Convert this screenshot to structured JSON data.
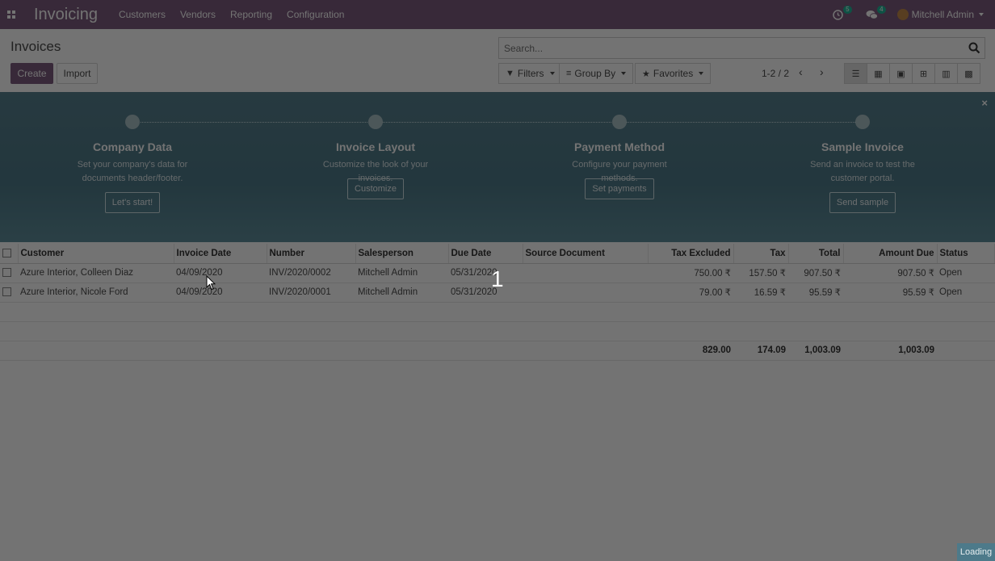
{
  "navbar": {
    "app_name": "Invoicing",
    "menu": [
      "Customers",
      "Vendors",
      "Reporting",
      "Configuration"
    ],
    "activity_count": "5",
    "messages_count": "4",
    "user": "Mitchell Admin"
  },
  "control_panel": {
    "title": "Invoices",
    "create_label": "Create",
    "import_label": "Import",
    "search_placeholder": "Search...",
    "filters_label": "Filters",
    "groupby_label": "Group By",
    "favorites_label": "Favorites",
    "pager": "1-2 / 2"
  },
  "onboarding": {
    "steps": [
      {
        "title": "Company Data",
        "desc": "Set your company's data for documents header/footer.",
        "button": "Let's start!"
      },
      {
        "title": "Invoice Layout",
        "desc": "Customize the look of your invoices.",
        "button": "Customize"
      },
      {
        "title": "Payment Method",
        "desc": "Configure your payment methods.",
        "button": "Set payments"
      },
      {
        "title": "Sample Invoice",
        "desc": "Send an invoice to test the customer portal.",
        "button": "Send sample"
      }
    ]
  },
  "table": {
    "columns": [
      "Customer",
      "Invoice Date",
      "Number",
      "Salesperson",
      "Due Date",
      "Source Document",
      "Tax Excluded",
      "Tax",
      "Total",
      "Amount Due",
      "Status"
    ],
    "rows": [
      {
        "customer": "Azure Interior, Colleen Diaz",
        "invoice_date": "04/09/2020",
        "number": "INV/2020/0002",
        "salesperson": "Mitchell Admin",
        "due_date": "05/31/2020",
        "source": "",
        "tax_excluded": "750.00 ₹",
        "tax": "157.50 ₹",
        "total": "907.50 ₹",
        "amount_due": "907.50 ₹",
        "status": "Open"
      },
      {
        "customer": "Azure Interior, Nicole Ford",
        "invoice_date": "04/09/2020",
        "number": "INV/2020/0001",
        "salesperson": "Mitchell Admin",
        "due_date": "05/31/2020",
        "source": "",
        "tax_excluded": "79.00 ₹",
        "tax": "16.59 ₹",
        "total": "95.59 ₹",
        "amount_due": "95.59 ₹",
        "status": "Open"
      }
    ],
    "totals": {
      "tax_excluded": "829.00",
      "tax": "174.09",
      "total": "1,003.09",
      "amount_due": "1,003.09"
    }
  },
  "overlay": {
    "step_number": "1",
    "loading_label": "Loading"
  }
}
